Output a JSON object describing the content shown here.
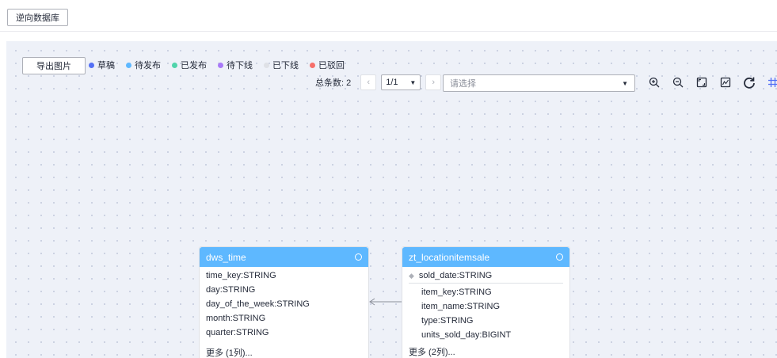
{
  "toolbar": {
    "reverse_db_label": "逆向数据库"
  },
  "canvas": {
    "export_label": "导出图片",
    "legend": [
      {
        "label": "草稿",
        "color": "#5470f5"
      },
      {
        "label": "待发布",
        "color": "#5eb8ff"
      },
      {
        "label": "已发布",
        "color": "#50d4ab"
      },
      {
        "label": "待下线",
        "color": "#a97af8"
      },
      {
        "label": "已下线",
        "color": "#dfe1e6"
      },
      {
        "label": "已驳回",
        "color": "#f66f6a"
      }
    ],
    "pager": {
      "total": "总条数: 2",
      "page": "1/1"
    },
    "select_placeholder": "请选择",
    "tools": [
      "zoom-in-icon",
      "zoom-out-icon",
      "fit-screen-icon",
      "thumbnail-icon",
      "refresh-icon",
      "grid-icon"
    ]
  },
  "tables": [
    {
      "name": "dws_time",
      "fields": [
        "time_key:STRING",
        "day:STRING",
        "day_of_the_week:STRING",
        "month:STRING",
        "quarter:STRING"
      ],
      "more": "更多 (1列)..."
    },
    {
      "name": "zt_locationitemsale",
      "key_field": "sold_date:STRING",
      "fields": [
        "item_key:STRING",
        "item_name:STRING",
        "type:STRING",
        "units_sold_day:BIGINT"
      ],
      "more": "更多 (2列)..."
    }
  ],
  "colors": {
    "accent": "#5eb8ff",
    "canvas_bg": "#eef1f8"
  }
}
